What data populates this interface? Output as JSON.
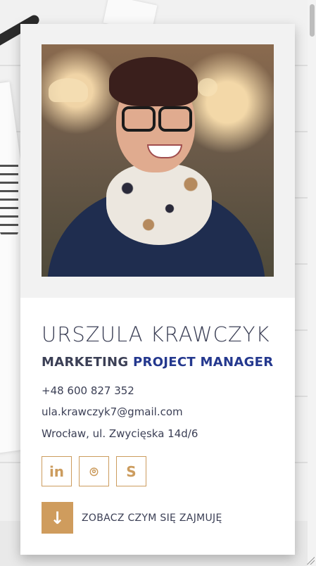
{
  "profile": {
    "name": "URSZULA KRAWCZYK",
    "role_part1": "MARKETING",
    "role_part2": "PROJECT MANAGER",
    "phone": "+48 600 827 352",
    "email": "ula.krawczyk7@gmail.com",
    "address": "Wrocław, ul. Zwycięska 14d/6"
  },
  "socials": [
    {
      "icon": "linkedin-icon",
      "glyph": "in"
    },
    {
      "icon": "github-icon",
      "glyph": "⌾"
    },
    {
      "icon": "skype-icon",
      "glyph": "S"
    }
  ],
  "cta": {
    "icon": "arrow-down-icon",
    "glyph": "↓",
    "label": "ZOBACZ CZYM SIĘ ZAJMUJĘ"
  },
  "colors": {
    "accent": "#cf9c5d",
    "text": "#3b3f55",
    "highlight": "#24388e"
  }
}
